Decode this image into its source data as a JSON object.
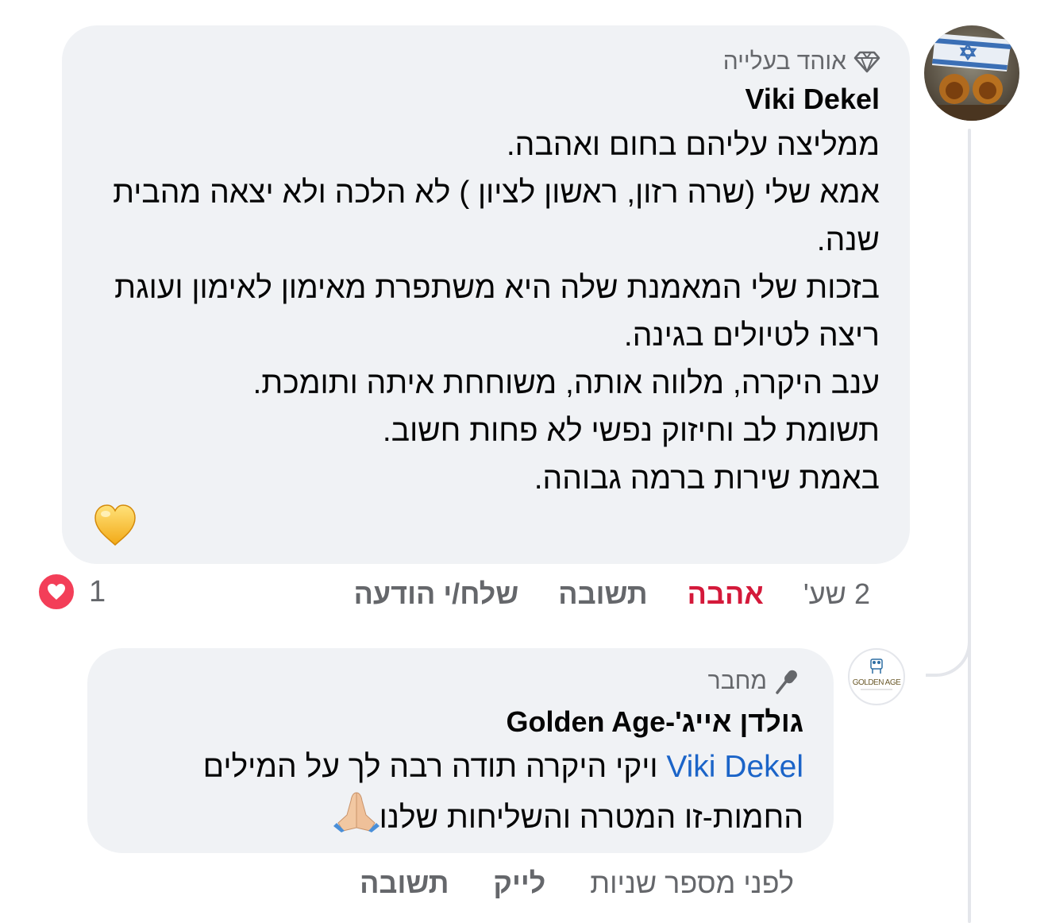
{
  "comment": {
    "badge_label": "אוהד בעלייה",
    "badge_icon": "diamond-icon",
    "author": "Viki Dekel",
    "lines": [
      "ממליצה עליהם בחום ואהבה.",
      "אמא שלי (שרה רזון, ראשון לציון ) לא הלכה ולא יצאה מהבית שנה.",
      "בזכות שלי המאמנת שלה היא משתפרת מאימון לאימון ועוגת ריצה לטיולים בגינה.",
      "ענב היקרה, מלווה אותה, משוחחת איתה ותומכת.",
      "תשומת לב וחיזוק נפשי לא פחות חשוב.",
      "באמת שירות ברמה גבוהה."
    ],
    "emoji": "yellow-heart",
    "time": "2 שע'",
    "love_label": "אהבה",
    "reply_label": "תשובה",
    "send_label": "שלח/י הודעה",
    "reaction_count": "1",
    "reaction_icon": "heart-reaction-icon"
  },
  "reply": {
    "badge_label": "מחבר",
    "badge_icon": "microphone-icon",
    "author": "גולדן אייג'-Golden Age",
    "avatar_text": "GOLDEN AGE",
    "mention": "Viki Dekel",
    "text": " ויקי היקרה תודה רבה לך על המילים החמות-זו המטרה והשליחות שלנו",
    "emoji": "folded-hands",
    "time": "לפני מספר שניות",
    "like_label": "לייק",
    "reply_label": "תשובה"
  },
  "colors": {
    "bubble": "#f0f2f5",
    "muted": "#65676b",
    "love": "#d4193a",
    "mention": "#1b64c8"
  }
}
